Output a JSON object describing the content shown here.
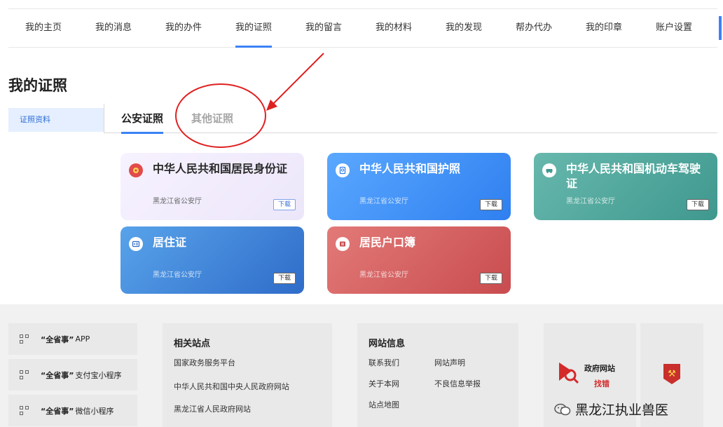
{
  "nav": {
    "tabs": [
      "我的主页",
      "我的消息",
      "我的办件",
      "我的证照",
      "我的留言",
      "我的材料",
      "我的发现",
      "帮办代办",
      "我的印章",
      "账户设置"
    ],
    "active": "我的证照"
  },
  "page_title": "我的证照",
  "side_menu": {
    "item": "证照资料"
  },
  "subtabs": {
    "tab1": "公安证照",
    "tab2": "其他证照"
  },
  "cards": [
    {
      "title": "中华人民共和国居民身份证",
      "org": "黑龙江省公安厅",
      "download": "下载",
      "icon": "badge-icon"
    },
    {
      "title": "中华人民共和国护照",
      "org": "黑龙江省公安厅",
      "download": "下载",
      "icon": "passport-icon"
    },
    {
      "title": "中华人民共和国机动车驾驶证",
      "org": "黑龙江省公安厅",
      "download": "下载",
      "icon": "car-icon"
    },
    {
      "title": "居住证",
      "org": "黑龙江省公安厅",
      "download": "下载",
      "icon": "id-card-icon"
    },
    {
      "title": "居民户口簿",
      "org": "黑龙江省公安厅",
      "download": "下载",
      "icon": "book-icon"
    }
  ],
  "footer": {
    "apps": [
      {
        "quote": "“全省事”",
        "suffix": " APP"
      },
      {
        "quote": "“全省事”",
        "suffix": " 支付宝小程序"
      },
      {
        "quote": "“全省事”",
        "suffix": " 微信小程序"
      }
    ],
    "related": {
      "heading": "相关站点",
      "links": [
        "国家政务服务平台",
        "中华人民共和国中央人民政府网站",
        "黑龙江省人民政府网站"
      ]
    },
    "site_info": {
      "heading": "网站信息",
      "links": [
        "联系我们",
        "网站声明",
        "关于本网",
        "不良信息举报",
        "站点地图"
      ]
    },
    "error_finder": {
      "line1": "政府网站",
      "line2": "找错"
    },
    "watermark": "黑龙江执业兽医"
  },
  "colors": {
    "accent": "#3b82f6",
    "annotation_red": "#e02020"
  }
}
